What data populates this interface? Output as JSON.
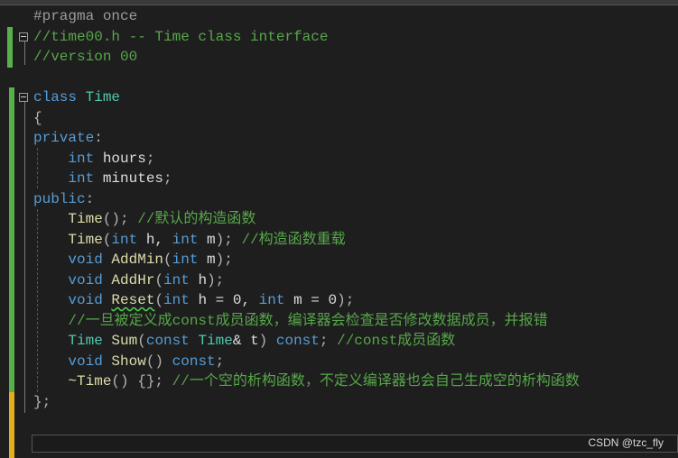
{
  "editor": {
    "colors": {
      "keyword": "#569cd6",
      "type": "#4ec9b0",
      "comment": "#57a64a",
      "function": "#dcdcaa",
      "text": "#dcdcdc",
      "background": "#1e1e1e",
      "change_saved": "#57b04a",
      "change_unsaved": "#e0b020"
    },
    "lines": [
      [
        {
          "t": "pp",
          "v": "#pragma once"
        }
      ],
      [
        {
          "t": "cm",
          "v": "//time00.h -- Time class interface"
        }
      ],
      [
        {
          "t": "cm",
          "v": "//version 00"
        }
      ],
      [],
      [
        {
          "t": "kw",
          "v": "class "
        },
        {
          "t": "ty",
          "v": "Time"
        }
      ],
      [
        {
          "t": "pu",
          "v": "{"
        }
      ],
      [
        {
          "t": "kw",
          "v": "private"
        },
        {
          "t": "pu",
          "v": ":"
        }
      ],
      [
        {
          "t": "pl",
          "v": "    "
        },
        {
          "t": "kw",
          "v": "int "
        },
        {
          "t": "pl",
          "v": "hours"
        },
        {
          "t": "pu",
          "v": ";"
        }
      ],
      [
        {
          "t": "pl",
          "v": "    "
        },
        {
          "t": "kw",
          "v": "int "
        },
        {
          "t": "pl",
          "v": "minutes"
        },
        {
          "t": "pu",
          "v": ";"
        }
      ],
      [
        {
          "t": "kw",
          "v": "public"
        },
        {
          "t": "pu",
          "v": ":"
        }
      ],
      [
        {
          "t": "pl",
          "v": "    "
        },
        {
          "t": "fn",
          "v": "Time"
        },
        {
          "t": "pu",
          "v": "(); "
        },
        {
          "t": "cm",
          "v": "//默认的构造函数"
        }
      ],
      [
        {
          "t": "pl",
          "v": "    "
        },
        {
          "t": "fn",
          "v": "Time"
        },
        {
          "t": "pu",
          "v": "("
        },
        {
          "t": "kw",
          "v": "int "
        },
        {
          "t": "pl",
          "v": "h, "
        },
        {
          "t": "kw",
          "v": "int "
        },
        {
          "t": "pl",
          "v": "m"
        },
        {
          "t": "pu",
          "v": "); "
        },
        {
          "t": "cm",
          "v": "//构造函数重载"
        }
      ],
      [
        {
          "t": "pl",
          "v": "    "
        },
        {
          "t": "kw",
          "v": "void "
        },
        {
          "t": "fn",
          "v": "AddMin"
        },
        {
          "t": "pu",
          "v": "("
        },
        {
          "t": "kw",
          "v": "int "
        },
        {
          "t": "pl",
          "v": "m"
        },
        {
          "t": "pu",
          "v": ");"
        }
      ],
      [
        {
          "t": "pl",
          "v": "    "
        },
        {
          "t": "kw",
          "v": "void "
        },
        {
          "t": "fn",
          "v": "AddHr"
        },
        {
          "t": "pu",
          "v": "("
        },
        {
          "t": "kw",
          "v": "int "
        },
        {
          "t": "pl",
          "v": "h"
        },
        {
          "t": "pu",
          "v": ");"
        }
      ],
      [
        {
          "t": "pl",
          "v": "    "
        },
        {
          "t": "kw",
          "v": "void "
        },
        {
          "t": "fn sq",
          "v": "Reset"
        },
        {
          "t": "pu",
          "v": "("
        },
        {
          "t": "kw",
          "v": "int "
        },
        {
          "t": "pl",
          "v": "h = 0, "
        },
        {
          "t": "kw",
          "v": "int "
        },
        {
          "t": "pl",
          "v": "m = 0"
        },
        {
          "t": "pu",
          "v": ");"
        }
      ],
      [
        {
          "t": "pl",
          "v": "    "
        },
        {
          "t": "cm",
          "v": "//一旦被定义成const成员函数，编译器会检查是否修改数据成员，并报错"
        }
      ],
      [
        {
          "t": "pl",
          "v": "    "
        },
        {
          "t": "ty",
          "v": "Time "
        },
        {
          "t": "fn",
          "v": "Sum"
        },
        {
          "t": "pu",
          "v": "("
        },
        {
          "t": "kw",
          "v": "const "
        },
        {
          "t": "ty",
          "v": "Time"
        },
        {
          "t": "pl",
          "v": "& t"
        },
        {
          "t": "pu",
          "v": ") "
        },
        {
          "t": "kw",
          "v": "const"
        },
        {
          "t": "pu",
          "v": "; "
        },
        {
          "t": "cm",
          "v": "//const成员函数"
        }
      ],
      [
        {
          "t": "pl",
          "v": "    "
        },
        {
          "t": "kw",
          "v": "void "
        },
        {
          "t": "fn",
          "v": "Show"
        },
        {
          "t": "pu",
          "v": "() "
        },
        {
          "t": "kw",
          "v": "const"
        },
        {
          "t": "pu",
          "v": ";"
        }
      ],
      [
        {
          "t": "pl",
          "v": "    "
        },
        {
          "t": "fn",
          "v": "~Time"
        },
        {
          "t": "pu",
          "v": "() {}; "
        },
        {
          "t": "cm",
          "v": "//一个空的析构函数，不定义编译器也会自己生成空的析构函数"
        }
      ],
      [
        {
          "t": "pu",
          "v": "};"
        }
      ]
    ]
  },
  "watermark": "CSDN @tzc_fly"
}
